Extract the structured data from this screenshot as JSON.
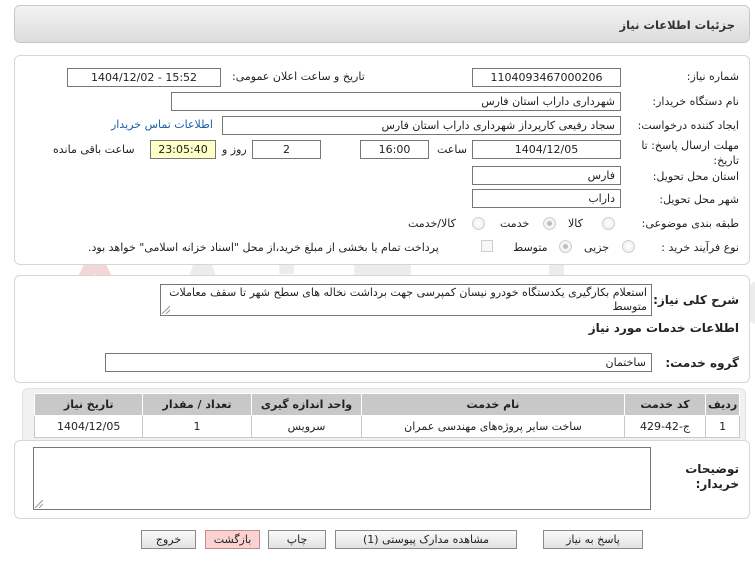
{
  "window": {
    "title": "جزئیات اطلاعات نیاز"
  },
  "form": {
    "need_number_label": "شماره نیاز:",
    "need_number": "1104093467000206",
    "announce_label": "تاریخ و ساعت اعلان عمومی:",
    "announce_value": "1404/12/02 - 15:52",
    "buyer_org_label": "نام دستگاه خریدار:",
    "buyer_org": "شهرداری داراب استان فارس",
    "creator_label": "ایجاد کننده درخواست:",
    "creator": "سجاد رفیعی کارپرداز  شهرداری داراب استان فارس",
    "contact_link": "اطلاعات تماس خریدار",
    "deadline_label": "مهلت ارسال پاسخ: تا تاریخ:",
    "deadline_date": "1404/12/05",
    "time_label": "ساعت",
    "deadline_time": "16:00",
    "days_value": "2",
    "days_label": "روز و",
    "remaining_time": "23:05:40",
    "remaining_label": "ساعت باقی مانده",
    "province_label": "استان محل تحویل:",
    "province": "فارس",
    "city_label": "شهر محل تحویل:",
    "city": "داراب",
    "category_label": "طبقه بندی موضوعی:",
    "category_options": [
      "کالا",
      "خدمت",
      "کالا/خدمت"
    ],
    "category_selected": "خدمت",
    "process_label": "نوع فرآیند خرید :",
    "process_options": [
      "جزیی",
      "متوسط"
    ],
    "process_selected": "متوسط",
    "payment_note": "پرداخت تمام یا بخشی از مبلغ خرید،از محل \"اسناد خزانه اسلامی\" خواهد بود."
  },
  "description": {
    "label": "شرح کلی نیاز:",
    "text": "استعلام بکارگیری یکدستگاه خودرو نیسان کمپرسی جهت برداشت نخاله های سطح شهر تا سقف معاملات متوسط"
  },
  "services": {
    "heading": "اطلاعات خدمات مورد نیاز",
    "group_label": "گروه خدمت:",
    "group_value": "ساختمان",
    "columns": [
      "ردیف",
      "کد خدمت",
      "نام خدمت",
      "واحد اندازه گیری",
      "تعداد / مقدار",
      "تاریخ نیاز"
    ],
    "rows": [
      [
        "1",
        "ج-42-429",
        "ساخت سایر پروژه‌های مهندسی عمران",
        "سرویس",
        "1",
        "1404/12/05"
      ]
    ]
  },
  "buyer_notes": {
    "label": "توضیحات خریدار:",
    "value": ""
  },
  "buttons": {
    "reply": "پاسخ به نیاز",
    "attachments": "مشاهده مدارک پیوستی (1)",
    "print": "چاپ",
    "back": "بازگشت",
    "exit": "خروج"
  },
  "colors": {
    "remaining_bg": "#ffffc8",
    "link": "#1b5fa8",
    "exit_bg": "#fbd2d2"
  }
}
